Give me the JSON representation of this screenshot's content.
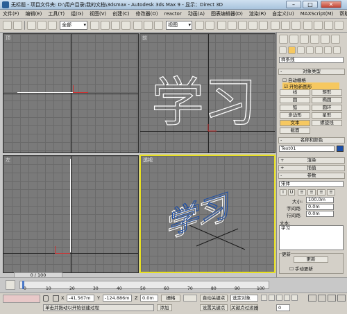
{
  "title_bar": {
    "text": "无标题 - 项目文件夹: D:\\用户目录\\我的文档\\3dsmax - Autodesk 3ds Max 9 - 显示：Direct 3D"
  },
  "menu": [
    "文件(F)",
    "编辑(E)",
    "工具(T)",
    "组(G)",
    "视图(V)",
    "创建(C)",
    "修改器(O)",
    "reactor",
    "动画(A)",
    "图表编辑器(D)",
    "渲染(R)",
    "自定义(U)",
    "MAXScript(M)",
    "帮助(H)"
  ],
  "toolbar": {
    "selection_filter": "全部",
    "ref_coord": "视图"
  },
  "viewports": {
    "top": "顶",
    "front": "前",
    "left": "左",
    "perspective": "透视",
    "text_glyphs": "学习"
  },
  "command_panel": {
    "category_dropdown": "样条线",
    "object_type_header": "对象类型",
    "autogrid_label": "自动栅格",
    "start_new_shape": "开始新图形",
    "buttons": [
      "线",
      "矩形",
      "圆",
      "椭圆",
      "弧",
      "圆环",
      "多边形",
      "星形",
      "文本",
      "螺旋线",
      "截面"
    ],
    "selected_button": "文本",
    "name_color_header": "名称和颜色",
    "object_name": "Text01",
    "object_color": "#1a4ea8",
    "rendering_header": "渲染",
    "interpolation_header": "插值",
    "parameters_header": "参数",
    "font": "宋体",
    "style_buttons": [
      "I",
      "U"
    ],
    "size_label": "大小:",
    "size_value": "100.0m",
    "kerning_label": "字间距:",
    "kerning_value": "0.0m",
    "leading_label": "行间距:",
    "leading_value": "0.0m",
    "text_label": "文本:",
    "text_value": "学习",
    "update_header": "更新",
    "update_button": "更新",
    "manual_update": "手动更新"
  },
  "timeline": {
    "frame_display": "0 / 100",
    "ticks": [
      "0",
      "10",
      "20",
      "30",
      "40",
      "50",
      "60",
      "70",
      "80",
      "90",
      "100"
    ]
  },
  "status": {
    "prompt": "单击并拖动以开始创建过程",
    "x_value": "-41.567m",
    "y_value": "-124.886m",
    "z_value": "0.0m",
    "grid_label": "栅格",
    "auto_key": "自动关键点",
    "selected_object": "选定对象",
    "set_key": "设置关键点",
    "key_filters": "关键点过滤器",
    "add_time_tag": "添加",
    "frame_field": "0"
  }
}
